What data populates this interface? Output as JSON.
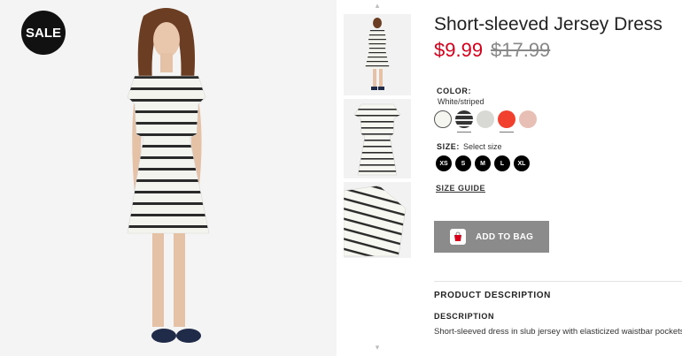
{
  "badge": {
    "label": "SALE"
  },
  "product": {
    "title": "Short-sleeved Jersey Dress",
    "price_sale": "$9.99",
    "price_original": "$17.99"
  },
  "color": {
    "label": "COLOR:",
    "selected": "White/striped",
    "swatches": [
      {
        "name": "white",
        "hex": "#f6f6f1"
      },
      {
        "name": "black-striped",
        "hex": "#444444"
      },
      {
        "name": "light-grey",
        "hex": "#d8d8d4"
      },
      {
        "name": "red",
        "hex": "#f2402f"
      },
      {
        "name": "light-pink",
        "hex": "#e8bfb5"
      }
    ]
  },
  "size": {
    "label": "SIZE:",
    "hint": "Select size",
    "options": [
      "XS",
      "S",
      "M",
      "L",
      "XL"
    ]
  },
  "size_guide": {
    "label": "SIZE GUIDE"
  },
  "cart": {
    "button_label": "ADD TO BAG",
    "icon": "shopping-bag-icon"
  },
  "description": {
    "section_title": "PRODUCT DESCRIPTION",
    "heading": "DESCRIPTION",
    "text": "Short-sleeved dress in slub jersey with elasticized waistbar pockets."
  },
  "gallery": {
    "up_arrow": "▴",
    "down_arrow": "▾"
  }
}
